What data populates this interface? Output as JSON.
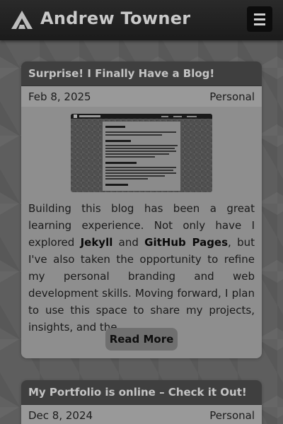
{
  "header": {
    "brand_name": "Andrew Towner",
    "logo_icon": "stylized-a-logo",
    "menu_icon": "hamburger-menu-icon"
  },
  "posts": [
    {
      "title": "Surprise! I Finally Have a Blog!",
      "date": "Feb 8, 2025",
      "category": "Personal",
      "thumbnail_icon": "about-me-page-screenshot",
      "excerpt": {
        "part1": "Building this blog has been a great learning experience. Not only have I explored ",
        "bold1": "Jekyll",
        "part2": " and ",
        "bold2": "GitHub Pages",
        "part3": ", but I've also taken the opportunity to refine my personal branding and web development skills. Moving forward, I plan to use this space to share my projects, insights, and the..."
      },
      "read_more_label": "Read More"
    },
    {
      "title": "My Portfolio is online – Check it Out!",
      "date": "Dec 8, 2024",
      "category": "Personal"
    }
  ],
  "colors": {
    "page_bg": "#5e5e5e",
    "navbar_bg": "#1f1f1f",
    "card_title_bg": "#3f3f3f",
    "card_meta_bg": "#999999",
    "card_body_bg": "#8e8e8e",
    "button_bg": "#6f6f6f"
  }
}
